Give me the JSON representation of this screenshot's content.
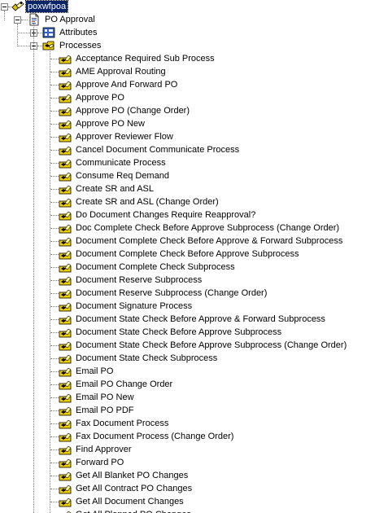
{
  "tree": {
    "root": {
      "label": "poxwfpoa",
      "icon": "workflow-item-type-icon",
      "selected": true
    },
    "item_type": {
      "label": "PO Approval",
      "icon": "item-type-document-icon"
    },
    "attributes": {
      "label": "Attributes",
      "icon": "attributes-icon",
      "expanded": false
    },
    "processes": {
      "label": "Processes",
      "icon": "processes-folder-icon",
      "expanded": true,
      "items": [
        "Acceptance Required Sub Process",
        "AME Approval Routing",
        "Approve And Forward PO",
        "Approve PO",
        "Approve PO (Change Order)",
        "Approve PO New",
        "Approver Reviewer Flow",
        "Cancel Document Communicate Process",
        "Communicate Process",
        "Consume Req Demand",
        "Create SR and ASL",
        "Create SR and ASL (Change Order)",
        "Do Document Changes Require Reapproval?",
        "Doc Complete Check Before Approve Subprocess (Change Order)",
        "Document Complete Check Before Approve & Forward Subprocess",
        "Document Complete Check Before Approve Subprocess",
        "Document Complete Check Subprocess",
        "Document Reserve Subprocess",
        "Document Reserve Subprocess (Change Order)",
        "Document Signature Process",
        "Document State Check Before Approve & Forward Subprocess",
        "Document State Check Before Approve Subprocess",
        "Document State Check Before Approve Subprocess (Change Order)",
        "Document State Check Subprocess",
        "Email PO",
        "Email PO Change Order",
        "Email PO New",
        "Email PO PDF",
        "Fax Document Process",
        "Fax Document Process (Change Order)",
        "Find Approver",
        "Forward PO",
        "Get All Blanket PO Changes",
        "Get All Contract PO Changes",
        "Get All Document Changes",
        "Get All Planned PO Changes"
      ]
    },
    "colors": {
      "selection_bg": "#0a246a",
      "selection_fg": "#ffffff",
      "tree_line": "#808080",
      "process_icon": "#f0d000"
    }
  }
}
